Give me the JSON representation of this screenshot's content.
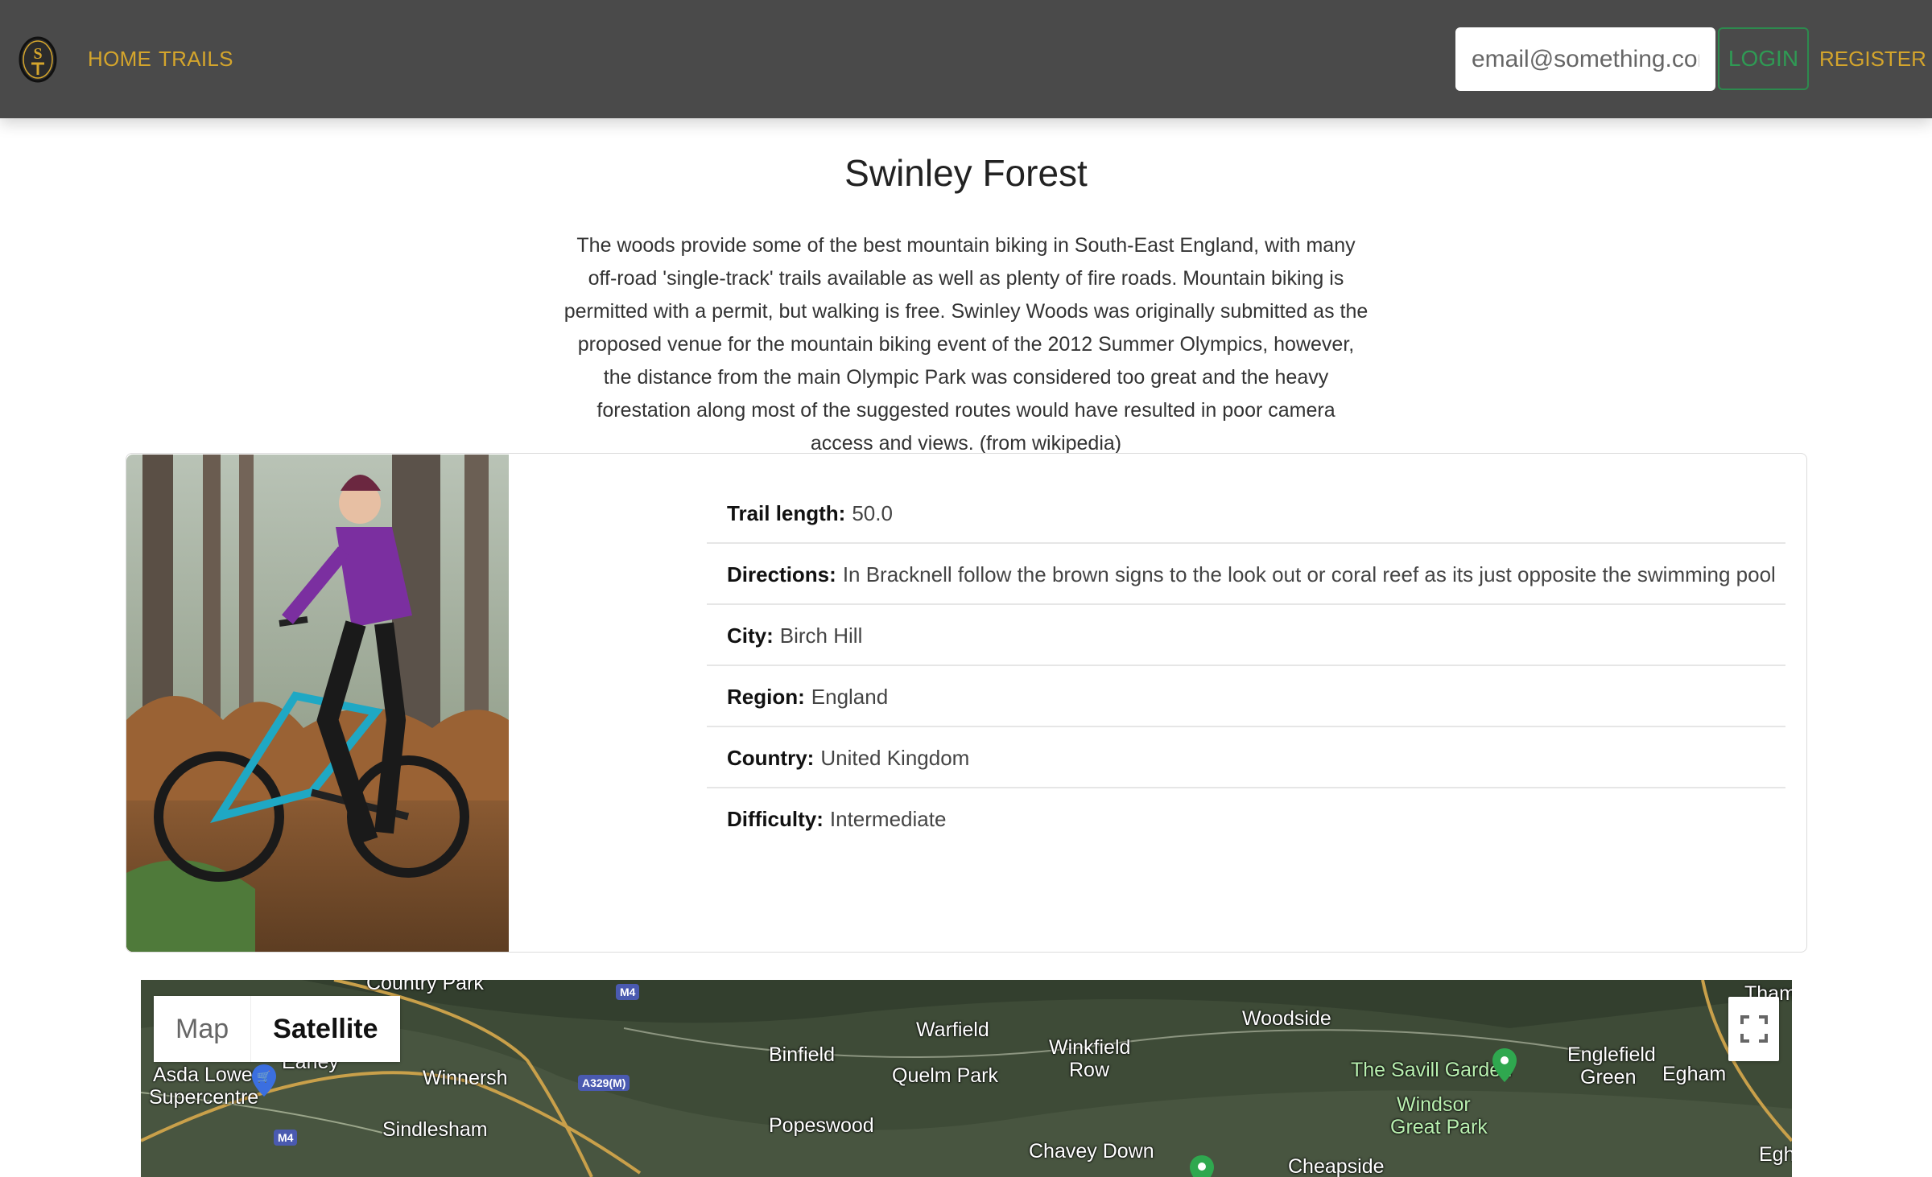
{
  "nav": {
    "logo_text": "ST",
    "links": [
      "HOME",
      "TRAILS"
    ],
    "email_placeholder": "email@something.com",
    "login_label": "LOGIN",
    "register_label": "REGISTER"
  },
  "trail": {
    "title": "Swinley Forest",
    "description": "The woods provide some of the best mountain biking in South-East England, with many off-road 'single-track' trails available as well as plenty of fire roads. Mountain biking is permitted with a permit, but walking is free. Swinley Woods was originally submitted as the proposed venue for the mountain biking event of the 2012 Summer Olympics, however, the distance from the main Olympic Park was considered too great and the heavy forestation along most of the suggested routes would have resulted in poor camera access and views. (from wikipedia)",
    "details": [
      {
        "label": "Trail length:",
        "value": "50.0"
      },
      {
        "label": "Directions:",
        "value": "In Bracknell follow the brown signs to the look out or coral reef as its just opposite the swimming pool"
      },
      {
        "label": "City:",
        "value": "Birch Hill"
      },
      {
        "label": "Region:",
        "value": "England"
      },
      {
        "label": "Country:",
        "value": "United Kingdom"
      },
      {
        "label": "Difficulty:",
        "value": "Intermediate"
      }
    ]
  },
  "map": {
    "type_options": [
      "Map",
      "Satellite"
    ],
    "selected_type": "Satellite",
    "labels": [
      "Country Park",
      "Asda Lower",
      "Supercentre",
      "Earley",
      "Winnersh",
      "Sindlesham",
      "Binfield",
      "Warfield",
      "Quelm Park",
      "Popeswood",
      "Winkfield",
      "Row",
      "Chavey Down",
      "Woodside",
      "Cheapside",
      "The Savill Garden",
      "Windsor",
      "Great Park",
      "Englefield",
      "Green",
      "Egham",
      "Thame",
      "Egh"
    ],
    "road_shields": [
      "M4",
      "A329(M)",
      "M4"
    ]
  },
  "colors": {
    "navbar_bg": "#4a4a4a",
    "nav_link": "#d4a52c",
    "login_green": "#2f9a54"
  }
}
